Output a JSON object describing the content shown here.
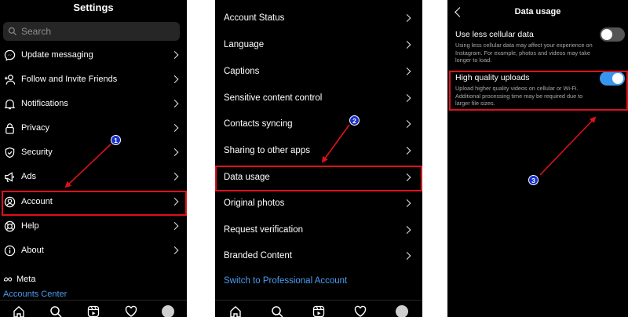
{
  "panel1": {
    "title": "Settings",
    "search_placeholder": "Search",
    "items": [
      {
        "label": "Update messaging",
        "icon": "messenger-icon"
      },
      {
        "label": "Follow and Invite Friends",
        "icon": "add-person-icon"
      },
      {
        "label": "Notifications",
        "icon": "bell-icon"
      },
      {
        "label": "Privacy",
        "icon": "lock-icon"
      },
      {
        "label": "Security",
        "icon": "shield-icon"
      },
      {
        "label": "Ads",
        "icon": "megaphone-icon"
      },
      {
        "label": "Account",
        "icon": "account-icon"
      },
      {
        "label": "Help",
        "icon": "lifebuoy-icon"
      },
      {
        "label": "About",
        "icon": "info-icon"
      }
    ],
    "meta_label": "Meta",
    "accounts_center": "Accounts Center"
  },
  "panel2": {
    "items": [
      {
        "label": "Account Status"
      },
      {
        "label": "Language"
      },
      {
        "label": "Captions"
      },
      {
        "label": "Sensitive content control"
      },
      {
        "label": "Contacts syncing"
      },
      {
        "label": "Sharing to other apps"
      },
      {
        "label": "Data usage"
      },
      {
        "label": "Original photos"
      },
      {
        "label": "Request verification"
      },
      {
        "label": "Branded Content"
      }
    ],
    "professional_link": "Switch to Professional Account"
  },
  "panel3": {
    "title": "Data usage",
    "settings": [
      {
        "title": "Use less cellular data",
        "description": "Using less cellular data may affect your experience on Instagram. For example, photos and videos may take longer to load.",
        "enabled": false
      },
      {
        "title": "High quality uploads",
        "description": "Upload higher quality videos on cellular or Wi-Fi. Additional processing time may be required due to larger file sizes.",
        "enabled": true
      }
    ]
  },
  "annotations": {
    "step1": "1",
    "step2": "2",
    "step3": "3",
    "highlight_color": "#e0101c",
    "badge_color": "#1a2fc8"
  },
  "colors": {
    "background": "#000000",
    "link": "#4d9cf0",
    "toggle_on": "#3797f0"
  }
}
